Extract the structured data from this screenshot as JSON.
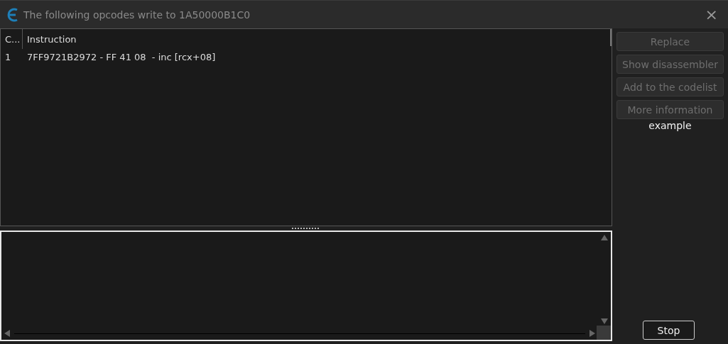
{
  "window": {
    "title": "The following opcodes write to 1A50000B1C0",
    "close": "×"
  },
  "table": {
    "columns": [
      "C...",
      "Instruction"
    ],
    "rows": [
      {
        "cells": [
          "1",
          "7FF9721B2972 - FF 41 08  - inc [rcx+08]"
        ],
        "selected": false
      }
    ]
  },
  "buttons": [
    {
      "label": "Replace",
      "disabled": true
    },
    {
      "label": "Show disassembler",
      "disabled": true
    },
    {
      "label": "Add to the codelist",
      "disabled": true
    },
    {
      "label": "More information",
      "disabled": true
    }
  ],
  "info_label": "example",
  "stop_button": {
    "label": "Stop"
  }
}
